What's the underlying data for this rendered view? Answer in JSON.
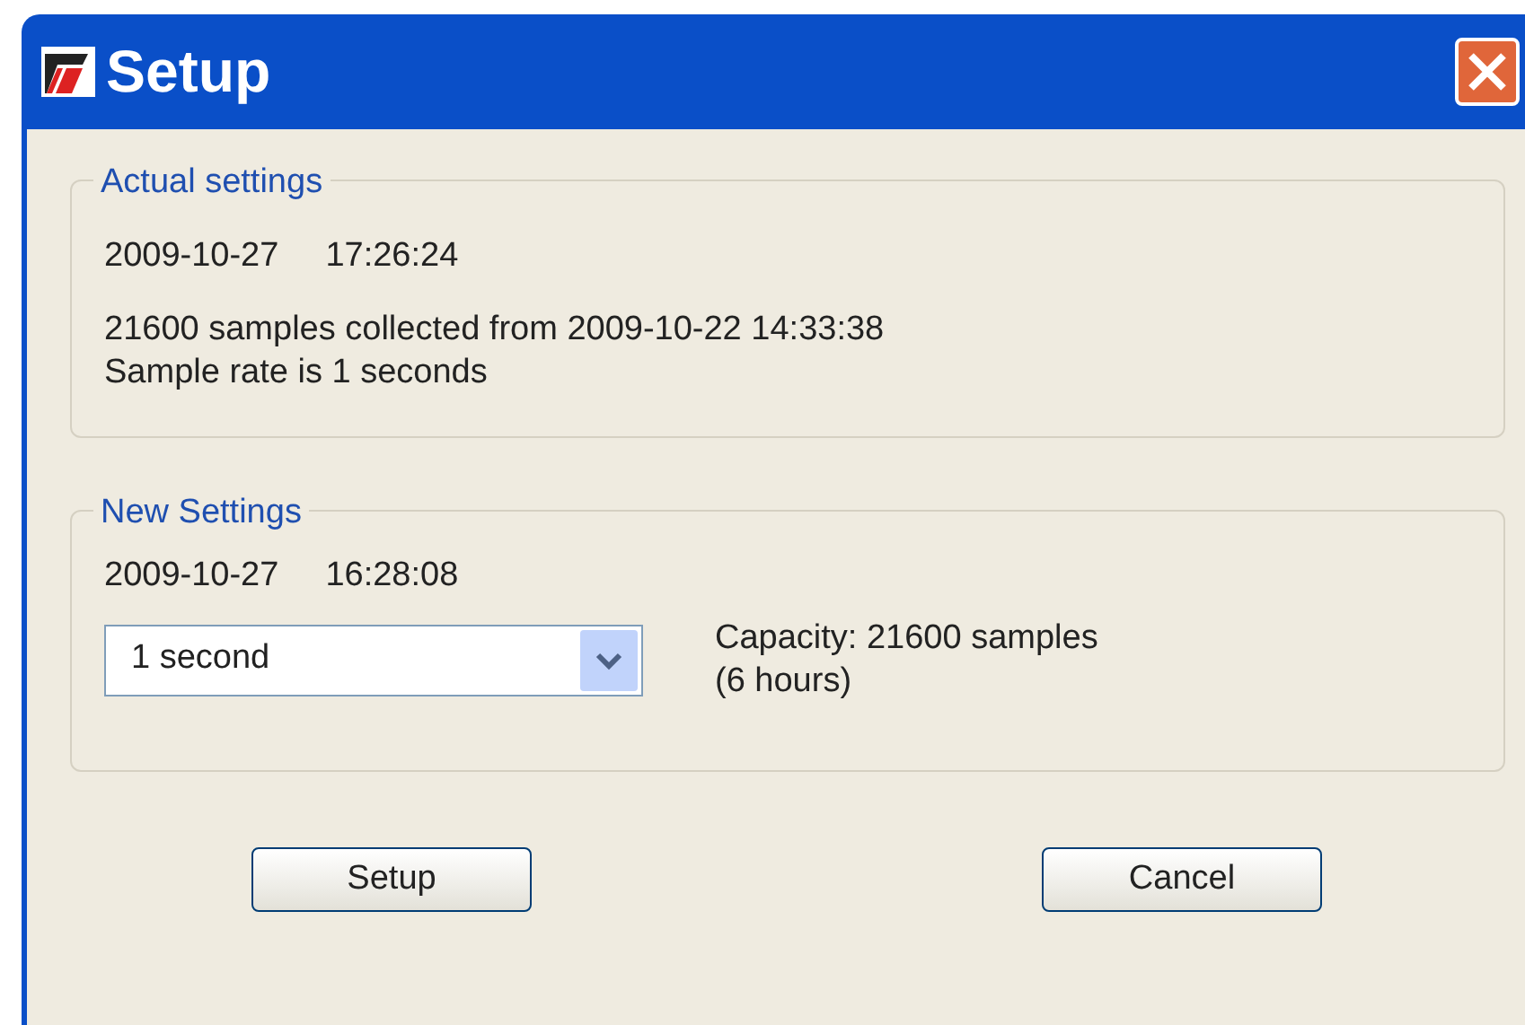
{
  "window": {
    "title": "Setup"
  },
  "actual_settings": {
    "title": "Actual settings",
    "date": "2009-10-27",
    "time": "17:26:24",
    "collected": "21600 samples collected from 2009-10-22 14:33:38",
    "rate": "Sample rate is 1 seconds"
  },
  "new_settings": {
    "title": "New Settings",
    "date": "2009-10-27",
    "time": "16:28:08",
    "rate_select": {
      "value": "1 second"
    },
    "capacity": "Capacity: 21600 samples",
    "duration": "(6 hours)"
  },
  "buttons": [
    {
      "label": "Setup"
    },
    {
      "label": "Cancel"
    }
  ]
}
